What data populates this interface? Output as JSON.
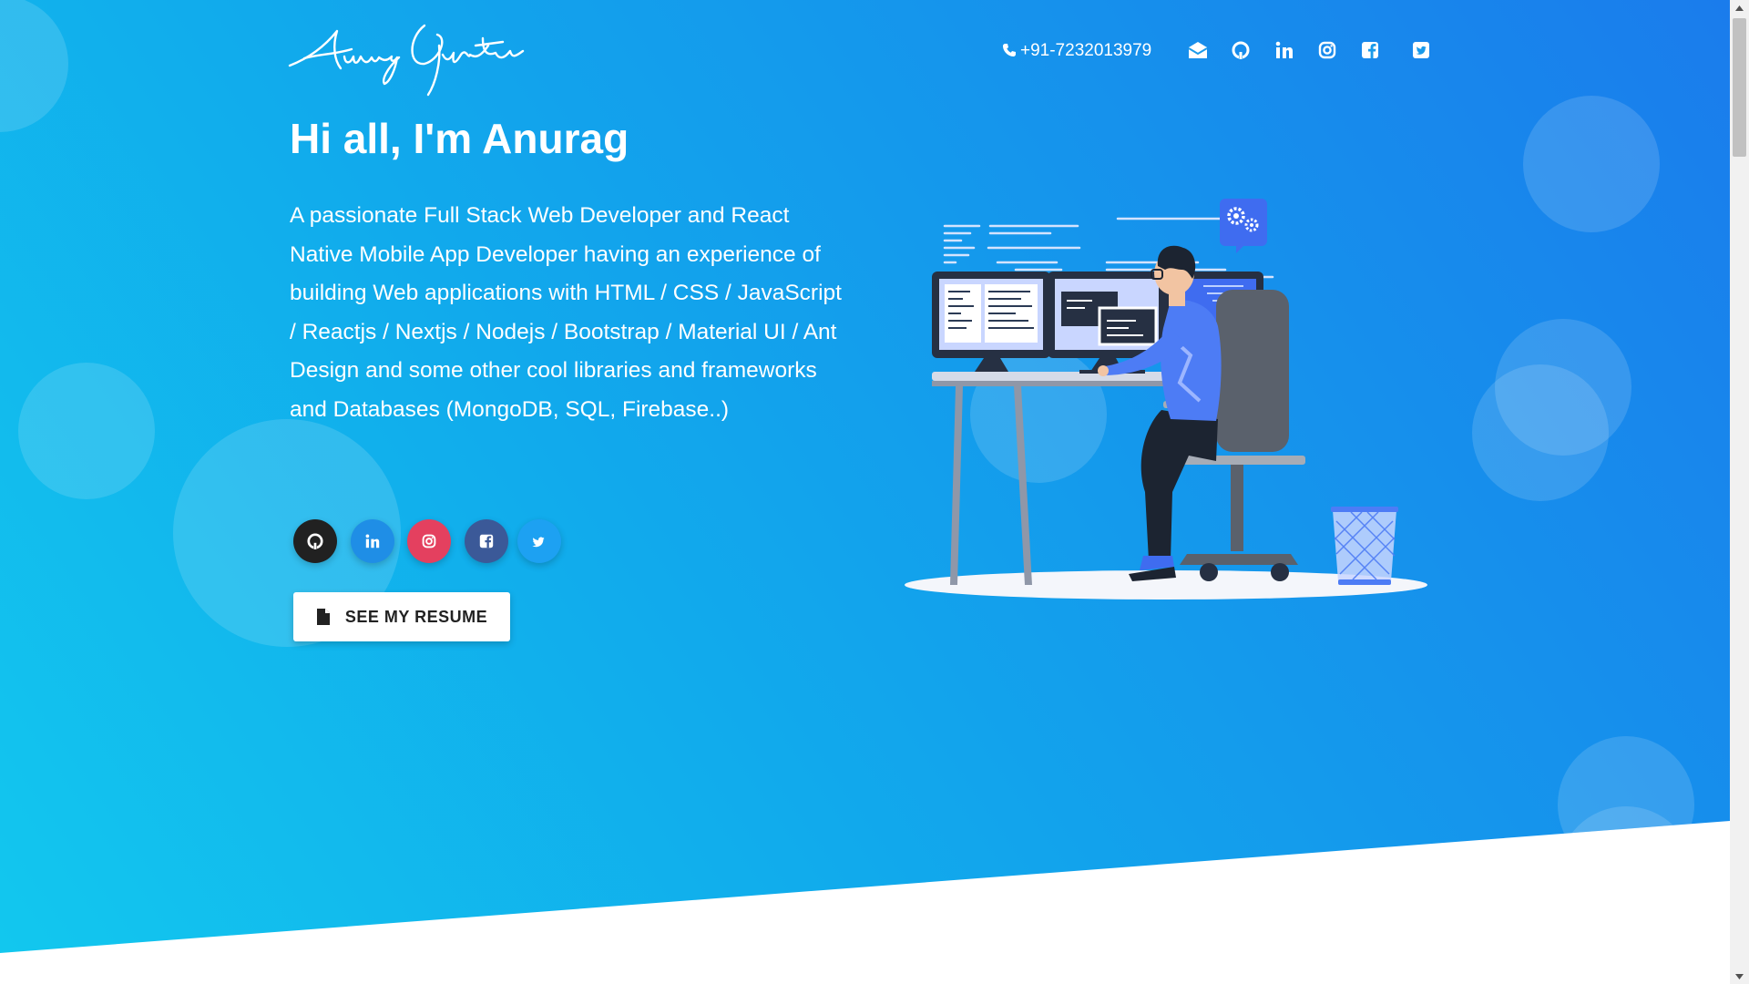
{
  "header": {
    "logo_text": "Anurag Gupta",
    "phone": "+91-7232013979",
    "nav_icons": [
      "envelope-icon",
      "github-icon",
      "linkedin-icon",
      "instagram-icon",
      "facebook-icon",
      "twitter-icon"
    ]
  },
  "hero": {
    "greeting": "Hi all, I'm Anurag",
    "description": "A passionate Full Stack Web Developer and React Native Mobile App Developer having an experience of building Web applications with HTML / CSS / JavaScript / Reactjs / Nextjs / Nodejs / Bootstrap / Material UI / Ant Design and some other cool libraries and frameworks and Databases (MongoDB, SQL, Firebase..)",
    "social_buttons": [
      {
        "icon": "github-icon",
        "color": "#212121"
      },
      {
        "icon": "linkedin-icon",
        "color": "#1f8ee6"
      },
      {
        "icon": "instagram-icon",
        "color": "#e4405f"
      },
      {
        "icon": "facebook-icon",
        "color": "#3b5998"
      },
      {
        "icon": "twitter-icon",
        "color": "#1da1f2"
      }
    ],
    "resume_button": "SEE MY RESUME"
  },
  "colors": {
    "gradient_start": "#12c8ee",
    "gradient_end": "#1a7cec",
    "text": "#ffffff"
  }
}
